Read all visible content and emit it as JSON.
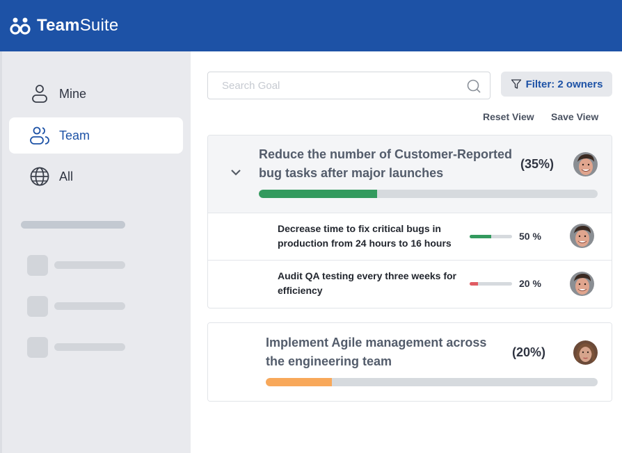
{
  "app": {
    "brand_bold": "Team",
    "brand_light": "Suite",
    "logo_icon": "team-logo-icon"
  },
  "sidebar": {
    "items": [
      {
        "label": "Mine",
        "icon": "user-icon",
        "active": false
      },
      {
        "label": "Team",
        "icon": "users-icon",
        "active": true
      },
      {
        "label": "All",
        "icon": "globe-icon",
        "active": false
      }
    ]
  },
  "toolbar": {
    "search_placeholder": "Search Goal",
    "search_value": "",
    "filter_label": "Filter: 2 owners",
    "reset_view": "Reset View",
    "save_view": "Save View"
  },
  "colors": {
    "brand": "#1d52a6",
    "green": "#339a5e",
    "red": "#e05c63",
    "orange": "#f8a85a",
    "track": "#d6dade"
  },
  "goals": [
    {
      "title": "Reduce the number of Customer-Reported bug tasks after major launches",
      "percent_label": "(35%)",
      "progress": 35,
      "color": "#339a5e",
      "expanded": true,
      "owner": "male-avatar",
      "subgoals": [
        {
          "title": "Decrease time to fix critical bugs in production from 24 hours to 16 hours",
          "percent_label": "50 %",
          "progress": 50,
          "color": "#339a5e",
          "owner": "male-avatar"
        },
        {
          "title": "Audit QA testing every three weeks for efficiency",
          "percent_label": "20 %",
          "progress": 20,
          "color": "#e05c63",
          "owner": "male-avatar"
        }
      ]
    },
    {
      "title": "Implement Agile management across the engineering team",
      "percent_label": "(20%)",
      "progress": 20,
      "color": "#f8a85a",
      "expanded": false,
      "owner": "female-avatar"
    }
  ]
}
